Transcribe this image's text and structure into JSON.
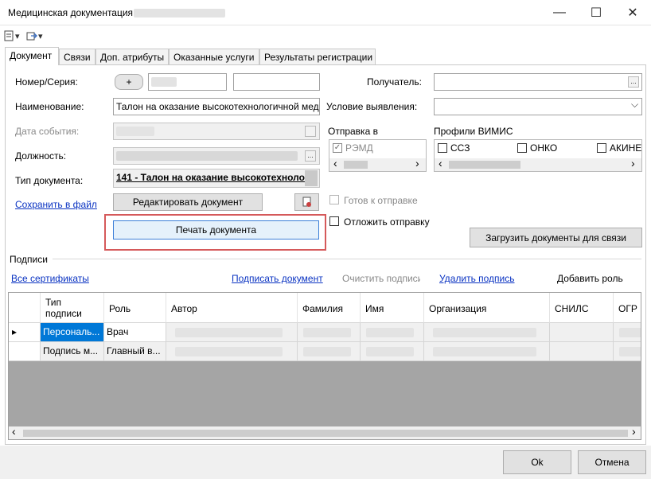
{
  "window": {
    "title": "Медицинская документация от",
    "minimize": "—",
    "maximize": "☐",
    "close": "✕"
  },
  "toolbar": {
    "btn1": "▾",
    "btn2": "▾"
  },
  "tabs": [
    {
      "label": "Документ"
    },
    {
      "label": "Связи"
    },
    {
      "label": "Доп. атрибуты"
    },
    {
      "label": "Оказанные услуги"
    },
    {
      "label": "Результаты регистрации"
    }
  ],
  "form": {
    "number_label": "Номер/Серия:",
    "plus_label": "+",
    "name_label": "Наименование:",
    "name_value": "Талон на оказание высокотехнологичной мед",
    "event_date_label": "Дата события:",
    "position_label": "Должность:",
    "doc_type_label": "Тип документа:",
    "doc_type_value": "141 - Талон на оказание высокотехноло",
    "recipient_label": "Получатель:",
    "detect_label": "Условие выявления:",
    "ellipsis": "...",
    "chevron": "⌵"
  },
  "send": {
    "label": "Отправка в",
    "remd": "РЭМД",
    "remd_checked": true
  },
  "vimis": {
    "label": "Профили ВИМИС",
    "items": [
      "ССЗ",
      "ОНКО",
      "АКИНЕ"
    ]
  },
  "actions": {
    "save_file": "Сохранить в файл",
    "edit_doc": "Редактировать документ",
    "print_doc": "Печать документа",
    "ready_send": "Готов к отправке",
    "delay_send": "Отложить отправку",
    "load_docs": "Загрузить документы для связи"
  },
  "signatures": {
    "section": "Подписи",
    "all_certs": "Все сертификаты",
    "sign_doc": "Подписать документ",
    "clear_sign": "Очистить подписи",
    "delete_sign": "Удалить подпись",
    "add_role": "Добавить роль",
    "columns": [
      "Тип подписи",
      "Роль",
      "Автор",
      "Фамилия",
      "Имя",
      "Организация",
      "СНИЛС",
      "ОГР"
    ],
    "rows": [
      {
        "type": "Персональ...",
        "role": "Врач"
      },
      {
        "type": "Подпись м...",
        "role": "Главный в..."
      }
    ]
  },
  "footer": {
    "ok": "Ok",
    "cancel": "Отмена"
  },
  "scroll": {
    "left": "‹",
    "right": "›",
    "row_marker": "▸"
  }
}
